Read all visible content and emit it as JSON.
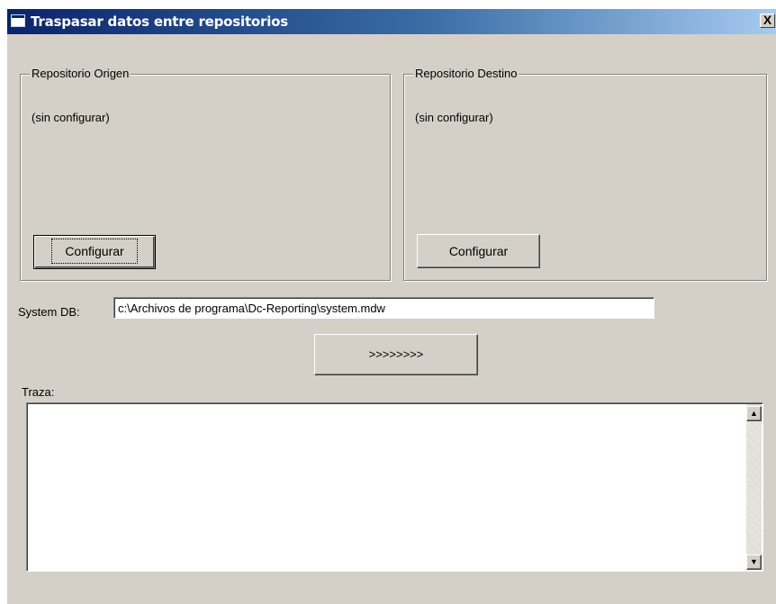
{
  "window": {
    "title": "Traspasar datos entre repositorios",
    "close_symbol": "X"
  },
  "origin": {
    "group_label": "Repositorio Origen",
    "status": "(sin configurar)",
    "configure_label": "Configurar"
  },
  "destination": {
    "group_label": "Repositorio Destino",
    "status": "(sin configurar)",
    "configure_label": "Configurar"
  },
  "system_db": {
    "label": "System DB:",
    "value": "c:\\Archivos de programa\\Dc-Reporting\\system.mdw"
  },
  "transfer": {
    "label": ">>>>>>>>"
  },
  "trace": {
    "label": "Traza:",
    "content": ""
  },
  "icons": {
    "window": "window-app-icon",
    "close": "close-icon",
    "scroll_up": "scroll-up-arrow-icon",
    "scroll_down": "scroll-down-arrow-icon"
  },
  "colors": {
    "titlebar_start": "#0a246a",
    "titlebar_end": "#a6caf0",
    "face": "#d4d0c8"
  }
}
